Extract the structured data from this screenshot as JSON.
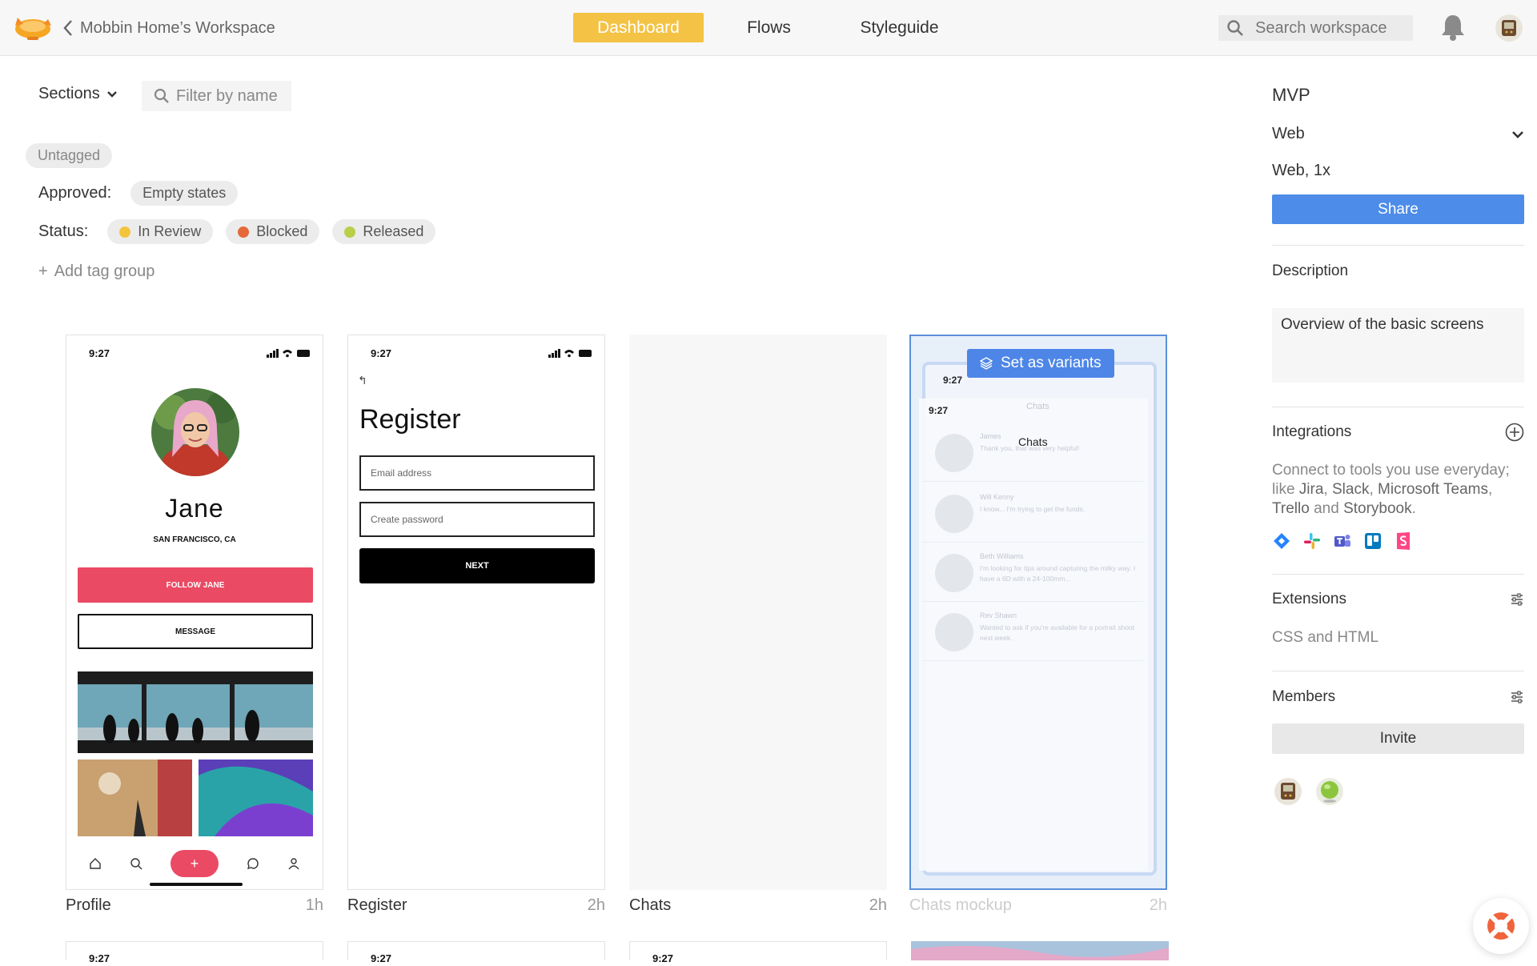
{
  "header": {
    "workspace": "Mobbin Home’s Workspace",
    "tabs": [
      {
        "label": "Dashboard"
      },
      {
        "label": "Flows"
      },
      {
        "label": "Styleguide"
      }
    ],
    "search_placeholder": "Search workspace"
  },
  "filters": {
    "sections_label": "Sections",
    "filter_placeholder": "Filter by name",
    "untagged": "Untagged",
    "approved_label": "Approved:",
    "approved_tags": [
      "Empty states"
    ],
    "status_label": "Status:",
    "status_tags": [
      {
        "label": "In Review",
        "color": "#f3c53c"
      },
      {
        "label": "Blocked",
        "color": "#e46a3a"
      },
      {
        "label": "Released",
        "color": "#b8cf4a"
      }
    ],
    "add_tag_group": "Add tag group"
  },
  "screens": [
    {
      "name": "Profile",
      "age": "1h",
      "time": "9:27",
      "user_name": "Jane",
      "location": "SAN FRANCISCO, CA",
      "follow_label": "FOLLOW JANE",
      "message_label": "MESSAGE",
      "plus": "+"
    },
    {
      "name": "Register",
      "age": "2h",
      "time": "9:27",
      "back": "↰",
      "title": "Register",
      "email_placeholder": "Email address",
      "password_placeholder": "Create password",
      "next_label": "NEXT"
    },
    {
      "name": "Chats",
      "age": "2h"
    },
    {
      "name": "Chats mockup",
      "age": "2h",
      "variants_label": "Set as variants",
      "time_top": "9:27",
      "time_inner": "9:27",
      "faint_title": "Chats",
      "title": "Chats",
      "conversations": [
        {
          "name": "James",
          "message": "Thank you, that was very helpful!"
        },
        {
          "name": "Will Kenny",
          "message": "I know... I'm trying to get the funds."
        },
        {
          "name": "Beth Williams",
          "message": "I'm looking for tips around capturing the milky way. I have a 6D with a 24-100mm..."
        },
        {
          "name": "Rev Shawn",
          "message": "Wanted to ask if you're available for a portrait shoot next week."
        }
      ]
    }
  ],
  "second_row_times": [
    "9:27",
    "9:27",
    "9:27"
  ],
  "panel": {
    "title": "MVP",
    "platform": "Web",
    "resolution": "Web, 1x",
    "share_label": "Share",
    "description_heading": "Description",
    "description": "Overview of the basic screens",
    "integrations_heading": "Integrations",
    "integrations_text_1": "Connect to tools you use everyday; like ",
    "integrations_tools": [
      "Jira",
      "Slack",
      "Microsoft Teams",
      "Trello",
      "Storybook"
    ],
    "integrations_sep_1": ", ",
    "integrations_sep_2": " and ",
    "integrations_end": ".",
    "extensions_heading": "Extensions",
    "extensions_text": "CSS and HTML",
    "members_heading": "Members",
    "invite_label": "Invite"
  },
  "colors": {
    "accent": "#f4c345",
    "primary": "#4d8ce8",
    "pink": "#ea4a64"
  }
}
